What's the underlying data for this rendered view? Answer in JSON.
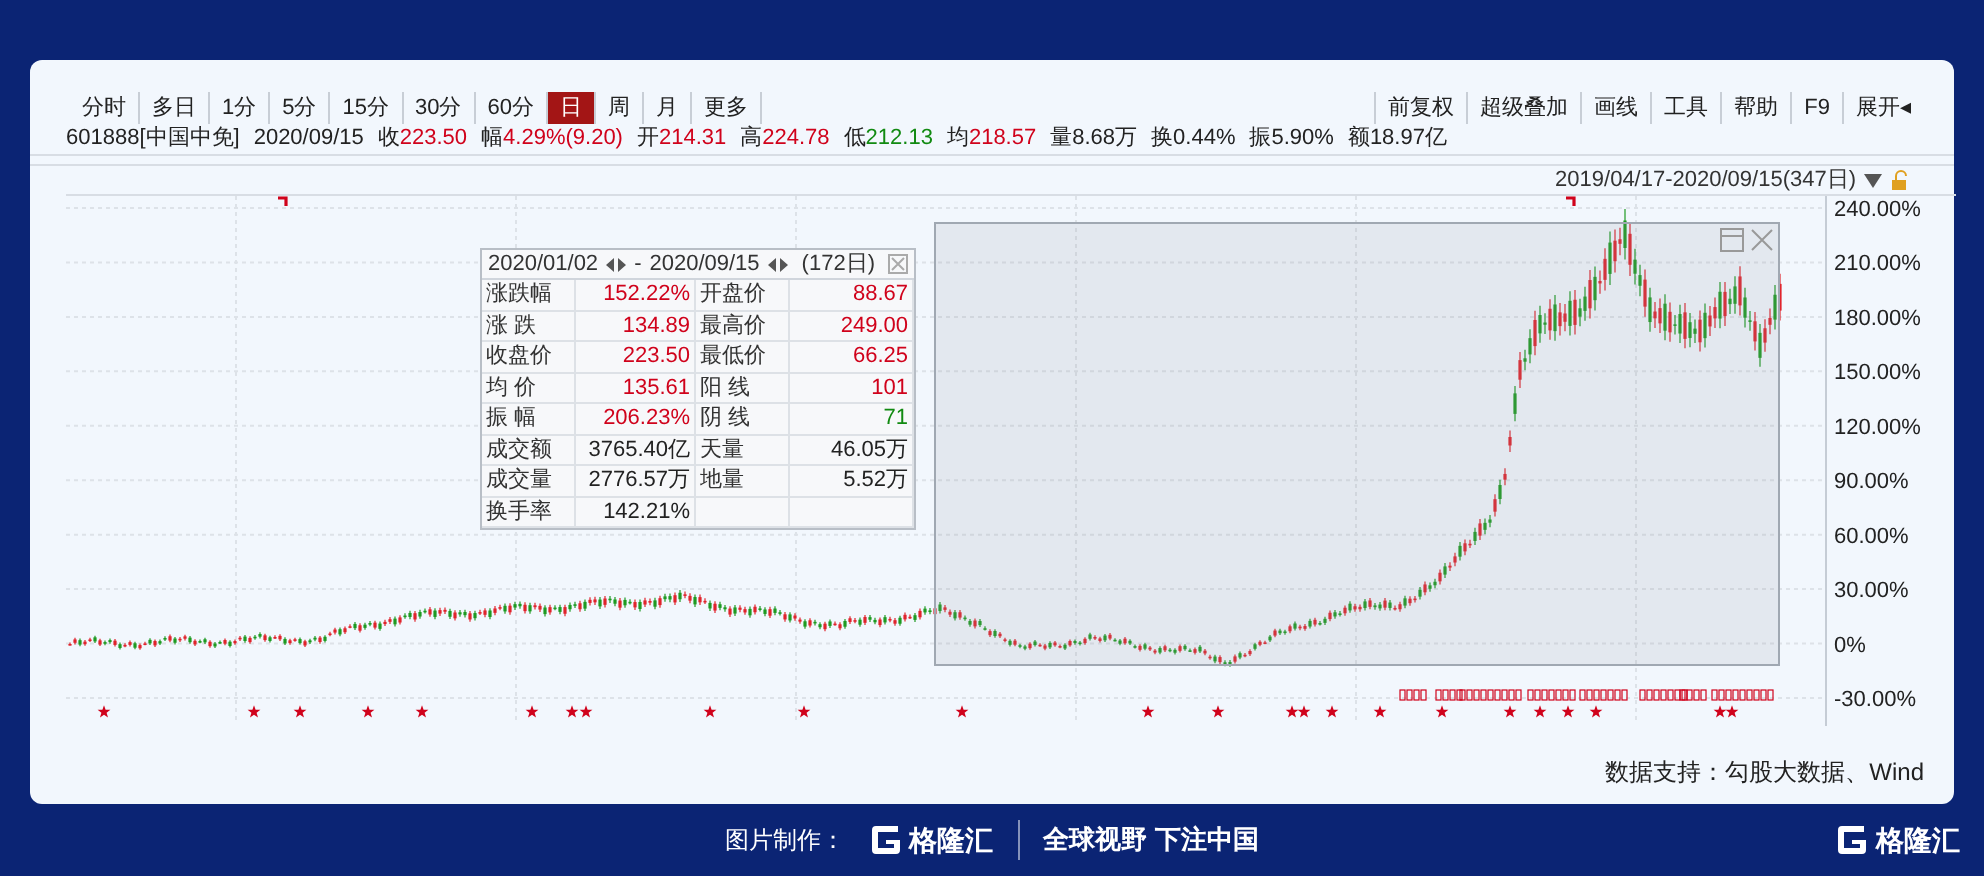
{
  "toolbar": {
    "periods": [
      {
        "label": "分时",
        "selected": false
      },
      {
        "label": "多日",
        "selected": false
      },
      {
        "label": "1分",
        "selected": false
      },
      {
        "label": "5分",
        "selected": false
      },
      {
        "label": "15分",
        "selected": false
      },
      {
        "label": "30分",
        "selected": false
      },
      {
        "label": "60分",
        "selected": false
      },
      {
        "label": "日",
        "selected": true
      },
      {
        "label": "周",
        "selected": false
      },
      {
        "label": "月",
        "selected": false
      },
      {
        "label": "更多",
        "selected": false
      }
    ],
    "tools": [
      "前复权",
      "超级叠加",
      "画线",
      "工具",
      "帮助",
      "F9",
      "展开◂"
    ]
  },
  "quote": [
    {
      "label": "601888[中国中免]"
    },
    {
      "label": "2020/09/15"
    },
    {
      "label": "收",
      "value": "223.50",
      "color": "#d0021b"
    },
    {
      "label": "幅",
      "value": "4.29%(9.20)",
      "color": "#d0021b"
    },
    {
      "label": "开",
      "value": "214.31",
      "color": "#d0021b"
    },
    {
      "label": "高",
      "value": "224.78",
      "color": "#d0021b"
    },
    {
      "label": "低",
      "value": "212.13",
      "color": "#118a11"
    },
    {
      "label": "均",
      "value": "218.57",
      "color": "#d0021b"
    },
    {
      "label": "量",
      "value": "8.68万"
    },
    {
      "label": "换",
      "value": "0.44%"
    },
    {
      "label": "振",
      "value": "5.90%"
    },
    {
      "label": "额",
      "value": "18.97亿"
    }
  ],
  "range": "2019/04/17-2020/09/15(347日)",
  "stats": {
    "start": "2020/01/02",
    "separator": "-",
    "end": "2020/09/15",
    "days": "(172日)",
    "rows": [
      {
        "cells": [
          {
            "label": "涨跌幅",
            "value": "152.22%",
            "color": "#d0021b"
          },
          {
            "label": "开盘价",
            "value": "88.67",
            "color": "#d0021b"
          }
        ]
      },
      {
        "cells": [
          {
            "label": "涨 跌",
            "value": "134.89",
            "color": "#d0021b"
          },
          {
            "label": "最高价",
            "value": "249.00",
            "color": "#d0021b"
          }
        ]
      },
      {
        "cells": [
          {
            "label": "收盘价",
            "value": "223.50",
            "color": "#d0021b"
          },
          {
            "label": "最低价",
            "value": "66.25",
            "color": "#d0021b"
          }
        ]
      },
      {
        "cells": [
          {
            "label": "均 价",
            "value": "135.61",
            "color": "#d0021b"
          },
          {
            "label": "阳 线",
            "value": "101",
            "color": "#d0021b"
          }
        ]
      },
      {
        "cells": [
          {
            "label": "振 幅",
            "value": "206.23%",
            "color": "#d0021b"
          },
          {
            "label": "阴 线",
            "value": "71",
            "color": "#118a11"
          }
        ]
      },
      {
        "cells": [
          {
            "label": "成交额",
            "value": "3765.40亿"
          },
          {
            "label": "天量",
            "value": "46.05万"
          }
        ]
      },
      {
        "cells": [
          {
            "label": "成交量",
            "value": "2776.57万"
          },
          {
            "label": "地量",
            "value": "5.52万"
          }
        ]
      },
      {
        "cells": [
          {
            "label": "换手率",
            "value": "142.21%"
          }
        ]
      }
    ]
  },
  "y_axis": [
    "240.00%",
    "210.00%",
    "180.00%",
    "150.00%",
    "120.00%",
    "90.00%",
    "60.00%",
    "30.00%",
    "0%",
    "-30.00%"
  ],
  "source": "数据支持：勾股大数据、Wind",
  "footer": {
    "credit": "图片制作：",
    "brand": "格隆汇",
    "slogan": "全球视野 下注中国",
    "corner_brand": "格隆汇"
  }
}
